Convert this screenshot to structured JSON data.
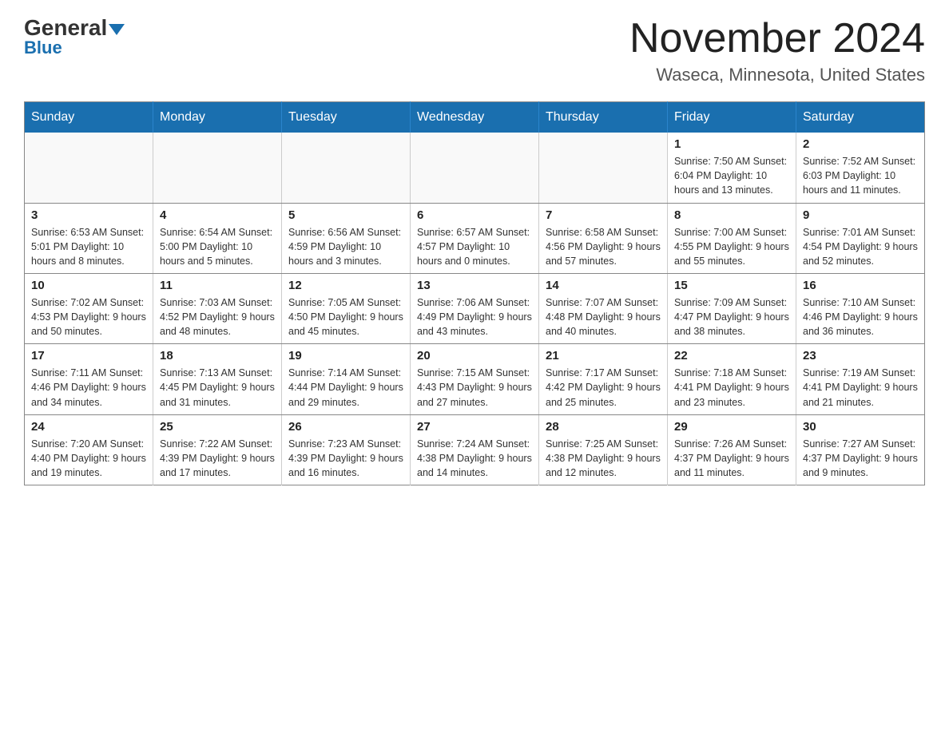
{
  "header": {
    "logo_general": "General",
    "logo_blue": "Blue",
    "title": "November 2024",
    "subtitle": "Waseca, Minnesota, United States"
  },
  "weekdays": [
    "Sunday",
    "Monday",
    "Tuesday",
    "Wednesday",
    "Thursday",
    "Friday",
    "Saturday"
  ],
  "weeks": [
    [
      {
        "day": "",
        "info": ""
      },
      {
        "day": "",
        "info": ""
      },
      {
        "day": "",
        "info": ""
      },
      {
        "day": "",
        "info": ""
      },
      {
        "day": "",
        "info": ""
      },
      {
        "day": "1",
        "info": "Sunrise: 7:50 AM\nSunset: 6:04 PM\nDaylight: 10 hours\nand 13 minutes."
      },
      {
        "day": "2",
        "info": "Sunrise: 7:52 AM\nSunset: 6:03 PM\nDaylight: 10 hours\nand 11 minutes."
      }
    ],
    [
      {
        "day": "3",
        "info": "Sunrise: 6:53 AM\nSunset: 5:01 PM\nDaylight: 10 hours\nand 8 minutes."
      },
      {
        "day": "4",
        "info": "Sunrise: 6:54 AM\nSunset: 5:00 PM\nDaylight: 10 hours\nand 5 minutes."
      },
      {
        "day": "5",
        "info": "Sunrise: 6:56 AM\nSunset: 4:59 PM\nDaylight: 10 hours\nand 3 minutes."
      },
      {
        "day": "6",
        "info": "Sunrise: 6:57 AM\nSunset: 4:57 PM\nDaylight: 10 hours\nand 0 minutes."
      },
      {
        "day": "7",
        "info": "Sunrise: 6:58 AM\nSunset: 4:56 PM\nDaylight: 9 hours\nand 57 minutes."
      },
      {
        "day": "8",
        "info": "Sunrise: 7:00 AM\nSunset: 4:55 PM\nDaylight: 9 hours\nand 55 minutes."
      },
      {
        "day": "9",
        "info": "Sunrise: 7:01 AM\nSunset: 4:54 PM\nDaylight: 9 hours\nand 52 minutes."
      }
    ],
    [
      {
        "day": "10",
        "info": "Sunrise: 7:02 AM\nSunset: 4:53 PM\nDaylight: 9 hours\nand 50 minutes."
      },
      {
        "day": "11",
        "info": "Sunrise: 7:03 AM\nSunset: 4:52 PM\nDaylight: 9 hours\nand 48 minutes."
      },
      {
        "day": "12",
        "info": "Sunrise: 7:05 AM\nSunset: 4:50 PM\nDaylight: 9 hours\nand 45 minutes."
      },
      {
        "day": "13",
        "info": "Sunrise: 7:06 AM\nSunset: 4:49 PM\nDaylight: 9 hours\nand 43 minutes."
      },
      {
        "day": "14",
        "info": "Sunrise: 7:07 AM\nSunset: 4:48 PM\nDaylight: 9 hours\nand 40 minutes."
      },
      {
        "day": "15",
        "info": "Sunrise: 7:09 AM\nSunset: 4:47 PM\nDaylight: 9 hours\nand 38 minutes."
      },
      {
        "day": "16",
        "info": "Sunrise: 7:10 AM\nSunset: 4:46 PM\nDaylight: 9 hours\nand 36 minutes."
      }
    ],
    [
      {
        "day": "17",
        "info": "Sunrise: 7:11 AM\nSunset: 4:46 PM\nDaylight: 9 hours\nand 34 minutes."
      },
      {
        "day": "18",
        "info": "Sunrise: 7:13 AM\nSunset: 4:45 PM\nDaylight: 9 hours\nand 31 minutes."
      },
      {
        "day": "19",
        "info": "Sunrise: 7:14 AM\nSunset: 4:44 PM\nDaylight: 9 hours\nand 29 minutes."
      },
      {
        "day": "20",
        "info": "Sunrise: 7:15 AM\nSunset: 4:43 PM\nDaylight: 9 hours\nand 27 minutes."
      },
      {
        "day": "21",
        "info": "Sunrise: 7:17 AM\nSunset: 4:42 PM\nDaylight: 9 hours\nand 25 minutes."
      },
      {
        "day": "22",
        "info": "Sunrise: 7:18 AM\nSunset: 4:41 PM\nDaylight: 9 hours\nand 23 minutes."
      },
      {
        "day": "23",
        "info": "Sunrise: 7:19 AM\nSunset: 4:41 PM\nDaylight: 9 hours\nand 21 minutes."
      }
    ],
    [
      {
        "day": "24",
        "info": "Sunrise: 7:20 AM\nSunset: 4:40 PM\nDaylight: 9 hours\nand 19 minutes."
      },
      {
        "day": "25",
        "info": "Sunrise: 7:22 AM\nSunset: 4:39 PM\nDaylight: 9 hours\nand 17 minutes."
      },
      {
        "day": "26",
        "info": "Sunrise: 7:23 AM\nSunset: 4:39 PM\nDaylight: 9 hours\nand 16 minutes."
      },
      {
        "day": "27",
        "info": "Sunrise: 7:24 AM\nSunset: 4:38 PM\nDaylight: 9 hours\nand 14 minutes."
      },
      {
        "day": "28",
        "info": "Sunrise: 7:25 AM\nSunset: 4:38 PM\nDaylight: 9 hours\nand 12 minutes."
      },
      {
        "day": "29",
        "info": "Sunrise: 7:26 AM\nSunset: 4:37 PM\nDaylight: 9 hours\nand 11 minutes."
      },
      {
        "day": "30",
        "info": "Sunrise: 7:27 AM\nSunset: 4:37 PM\nDaylight: 9 hours\nand 9 minutes."
      }
    ]
  ],
  "colors": {
    "header_bg": "#1a6faf",
    "header_text": "#ffffff",
    "border": "#888888",
    "day_number": "#222222",
    "day_info": "#333333"
  }
}
